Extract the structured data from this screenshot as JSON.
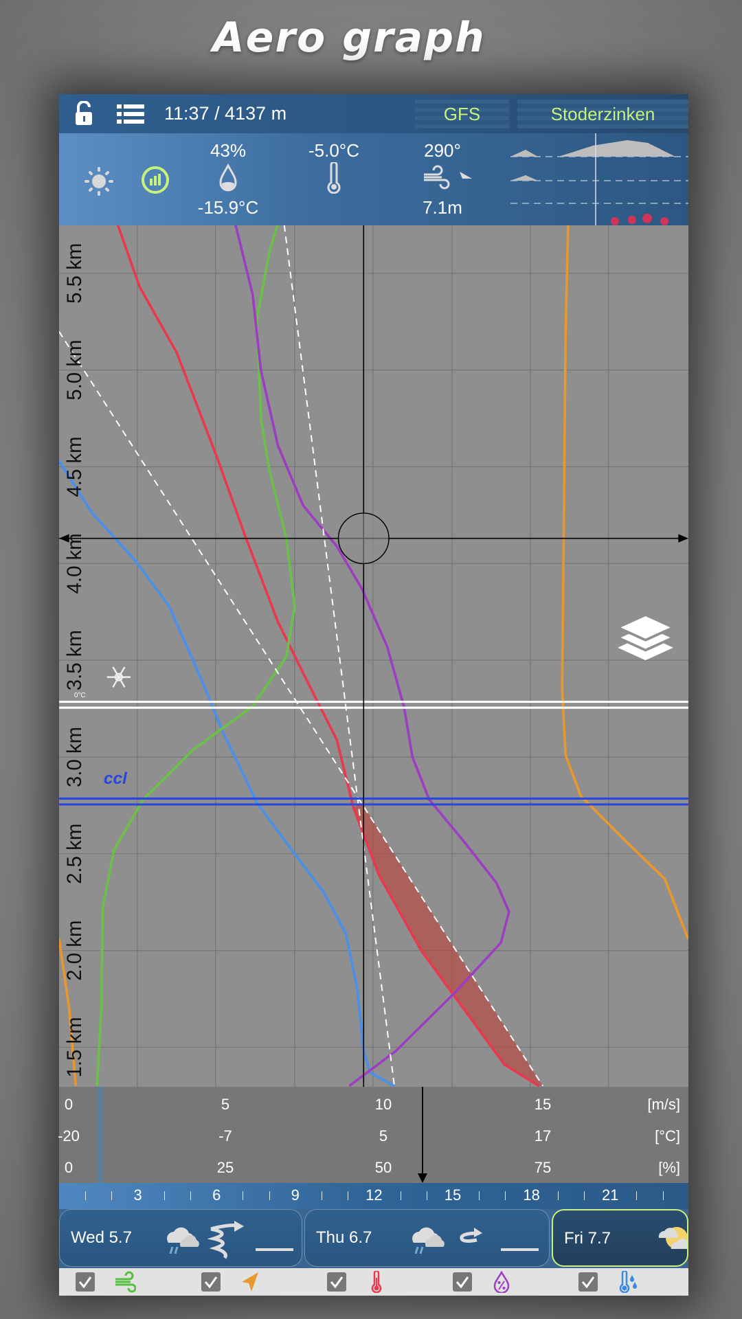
{
  "title": "Aero graph",
  "topbar": {
    "time_altitude": "11:37 / 4137 m",
    "model": "GFS",
    "location": "Stoderzinken"
  },
  "info": {
    "humidity": "43%",
    "dewpoint": "-15.9°C",
    "temperature": "-5.0°C",
    "wind_direction": "290°",
    "wind_speed": "7.1m"
  },
  "colors": {
    "accent_text": "#c7f27b",
    "temperature": "#e8394f",
    "dewpoint": "#4a90e8",
    "humidity": "#6cc04a",
    "wind_speed": "#9b3fc0",
    "orange_curve": "#e8982e",
    "ccl": "#2b45e0",
    "selected_day_border": "#c7f27b"
  },
  "chart_data": {
    "type": "line",
    "ylabel_unit": "km",
    "y_ticks": [
      "5.5 km",
      "5.0 km",
      "4.5 km",
      "4.0 km",
      "3.5 km",
      "3.0 km",
      "2.5 km",
      "2.0 km",
      "1.5 km"
    ],
    "y_tick_values": [
      5.5,
      5.0,
      4.5,
      4.0,
      3.5,
      3.0,
      2.5,
      2.0,
      1.5
    ],
    "ylim_km": [
      1.3,
      5.75
    ],
    "grid": true,
    "x_axes": [
      {
        "unit": "[m/s]",
        "ticks": [
          "0",
          "5",
          "10",
          "15"
        ],
        "range": [
          0,
          15
        ]
      },
      {
        "unit": "[°C]",
        "ticks": [
          "-20",
          "-7",
          "5",
          "17"
        ],
        "range": [
          -20,
          17
        ]
      },
      {
        "unit": "[%]",
        "ticks": [
          "0",
          "25",
          "50",
          "75"
        ],
        "range": [
          0,
          75
        ]
      }
    ],
    "series": [
      {
        "key": "temperature",
        "axis": "degC",
        "color": "#e8394f",
        "dashed": false,
        "points": [
          [
            -16.2,
            5.75
          ],
          [
            -14.5,
            5.43
          ],
          [
            -11.6,
            5.09
          ],
          [
            -8.4,
            4.54
          ],
          [
            -6.3,
            4.15
          ],
          [
            -3.7,
            3.7
          ],
          [
            -1.7,
            3.43
          ],
          [
            0.9,
            3.09
          ],
          [
            2.2,
            2.74
          ],
          [
            4.2,
            2.39
          ],
          [
            7.5,
            2.0
          ],
          [
            10.8,
            1.7
          ],
          [
            14.0,
            1.41
          ],
          [
            16.7,
            1.3
          ]
        ]
      },
      {
        "key": "dewpoint",
        "axis": "degC",
        "color": "#4a90e8",
        "dashed": false,
        "points": [
          [
            -20.8,
            4.53
          ],
          [
            -18.2,
            4.26
          ],
          [
            -14.9,
            4.02
          ],
          [
            -12.2,
            3.78
          ],
          [
            -9.6,
            3.39
          ],
          [
            -8.0,
            3.13
          ],
          [
            -5.3,
            2.76
          ],
          [
            -2.4,
            2.5
          ],
          [
            -0.1,
            2.3
          ],
          [
            1.6,
            2.09
          ],
          [
            2.5,
            1.8
          ],
          [
            3.0,
            1.48
          ],
          [
            3.5,
            1.37
          ],
          [
            5.4,
            1.3
          ]
        ]
      },
      {
        "key": "humidity",
        "axis": "pct",
        "color": "#6cc04a",
        "dashed": false,
        "points": [
          [
            33.0,
            5.75
          ],
          [
            31.7,
            5.61
          ],
          [
            29.7,
            5.26
          ],
          [
            30.4,
            4.74
          ],
          [
            31.7,
            4.48
          ],
          [
            34.4,
            4.13
          ],
          [
            35.7,
            3.78
          ],
          [
            34.4,
            3.52
          ],
          [
            29.0,
            3.26
          ],
          [
            19.7,
            3.04
          ],
          [
            11.7,
            2.78
          ],
          [
            7.1,
            2.52
          ],
          [
            5.3,
            2.22
          ],
          [
            5.1,
            1.7
          ],
          [
            4.4,
            1.3
          ]
        ]
      },
      {
        "key": "wind_speed",
        "axis": "ms",
        "color": "#9b3fc0",
        "dashed": false,
        "points": [
          [
            5.27,
            5.75
          ],
          [
            5.81,
            5.39
          ],
          [
            6.07,
            5.0
          ],
          [
            6.61,
            4.61
          ],
          [
            7.41,
            4.3
          ],
          [
            8.47,
            4.09
          ],
          [
            9.27,
            3.87
          ],
          [
            10.07,
            3.57
          ],
          [
            10.6,
            3.26
          ],
          [
            10.87,
            3.0
          ],
          [
            11.4,
            2.78
          ],
          [
            12.47,
            2.57
          ],
          [
            13.53,
            2.35
          ],
          [
            13.93,
            2.2
          ],
          [
            13.67,
            2.04
          ],
          [
            12.2,
            1.78
          ],
          [
            10.34,
            1.48
          ],
          [
            8.87,
            1.3
          ]
        ]
      },
      {
        "key": "orange",
        "axis": "ms",
        "color": "#e8982e",
        "dashed": false,
        "points": [
          [
            15.8,
            5.75
          ],
          [
            15.72,
            5.18
          ],
          [
            15.66,
            4.14
          ],
          [
            15.61,
            3.36
          ],
          [
            15.72,
            3.01
          ],
          [
            16.2,
            2.8
          ],
          [
            17.53,
            2.58
          ],
          [
            18.86,
            2.37
          ],
          [
            19.6,
            2.06
          ]
        ]
      },
      {
        "key": "orange_low",
        "axis": "ms",
        "color": "#e8982e",
        "dashed": false,
        "points": [
          [
            -0.32,
            2.06
          ],
          [
            0.0,
            1.7
          ],
          [
            0.21,
            1.3
          ]
        ]
      },
      {
        "key": "dry_adiabat",
        "axis": "degC",
        "color": "#ffffff",
        "dashed": true,
        "points": [
          [
            -20.8,
            5.2
          ],
          [
            17.0,
            1.3
          ]
        ]
      },
      {
        "key": "moist_line",
        "axis": "degC",
        "color": "#ffffff",
        "dashed": true,
        "points": [
          [
            -3.2,
            5.75
          ],
          [
            5.4,
            1.3
          ]
        ]
      }
    ],
    "shaded_area": {
      "color": "#b3504a",
      "top_km": 2.76
    },
    "freezing_level": {
      "km": 3.27,
      "label": "0°C"
    },
    "ccl": {
      "km": 2.77,
      "label": "ccl"
    },
    "crosshair": {
      "km": 4.13,
      "degC": 3.0
    }
  },
  "timeline": {
    "labels": [
      "3",
      "6",
      "9",
      "12",
      "15",
      "18",
      "21"
    ],
    "label_hours": [
      3,
      6,
      9,
      12,
      15,
      18,
      21
    ]
  },
  "days": [
    {
      "label": "Wed 5.7",
      "selected": false
    },
    {
      "label": "Thu 6.7",
      "selected": false
    },
    {
      "label": "Fri 7.7",
      "selected": true
    }
  ],
  "toggles": [
    {
      "name": "wind",
      "checked": true
    },
    {
      "name": "wind-direction",
      "checked": true
    },
    {
      "name": "temperature",
      "checked": true
    },
    {
      "name": "humidity",
      "checked": true
    },
    {
      "name": "dewpoint",
      "checked": true
    }
  ]
}
